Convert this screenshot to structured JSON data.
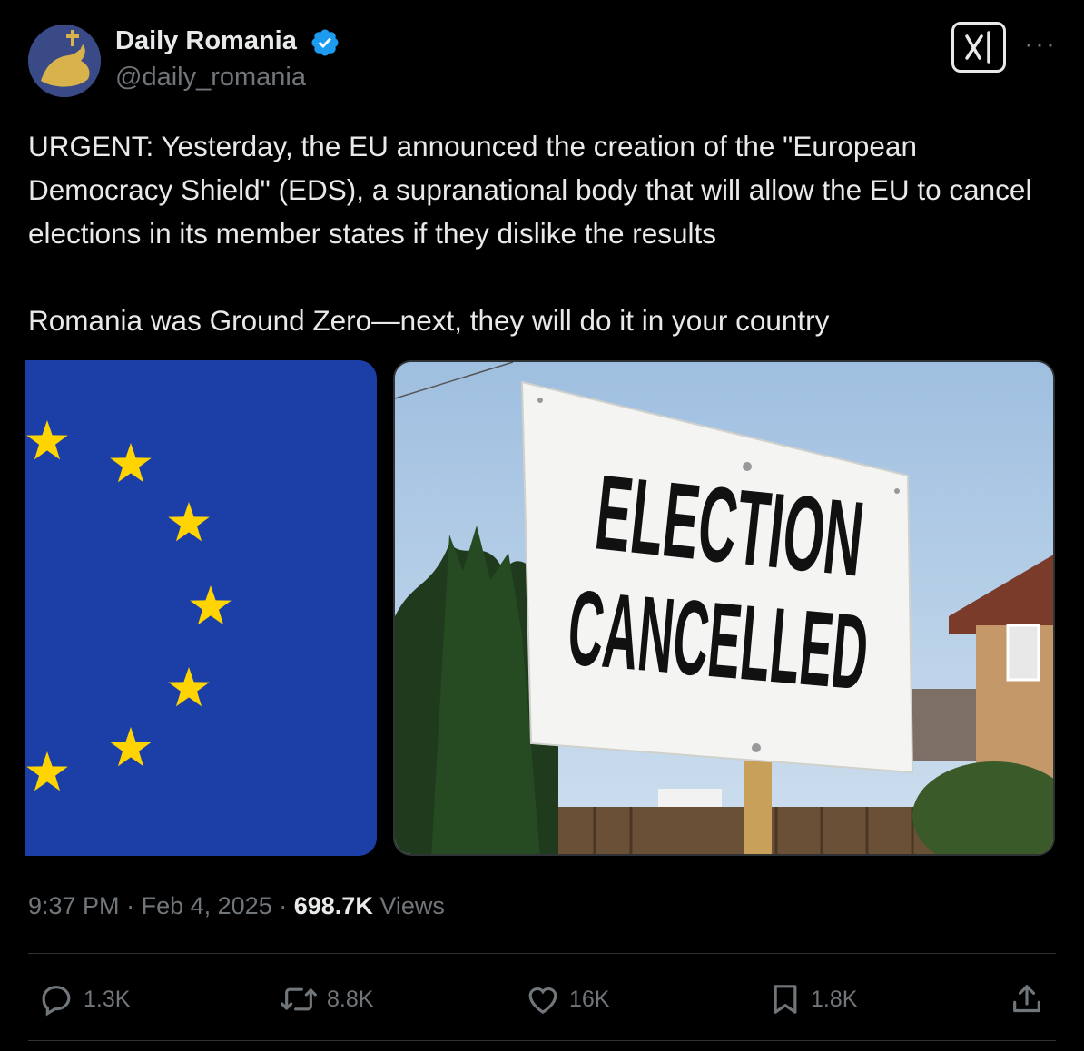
{
  "post": {
    "display_name": "Daily Romania",
    "handle": "@daily_romania",
    "verified_icon": "verified-badge-icon",
    "text": "URGENT: Yesterday, the EU announced the creation of the \"European Democracy Shield\" (EDS), a supranational body that will allow the EU to cancel elections in its member states if they dislike the results\n\nRomania was Ground Zero—next, they will do it in your country",
    "media": {
      "left_image": "eu-flag-stars",
      "right_image_sign_line1": "ELECTION",
      "right_image_sign_line2": "CANCELLED"
    },
    "time": "9:37 PM",
    "separator": "·",
    "date": "Feb 4, 2025",
    "views_count": "698.7K",
    "views_label": "Views"
  },
  "actions": {
    "replies": "1.3K",
    "reposts": "8.8K",
    "likes": "16K",
    "bookmarks": "1.8K"
  },
  "colors": {
    "background": "#000000",
    "text": "#e7e9ea",
    "muted": "#71767b",
    "verified": "#1d9bf0",
    "eu_blue": "#1b3fa6",
    "eu_gold": "#ffd400"
  }
}
